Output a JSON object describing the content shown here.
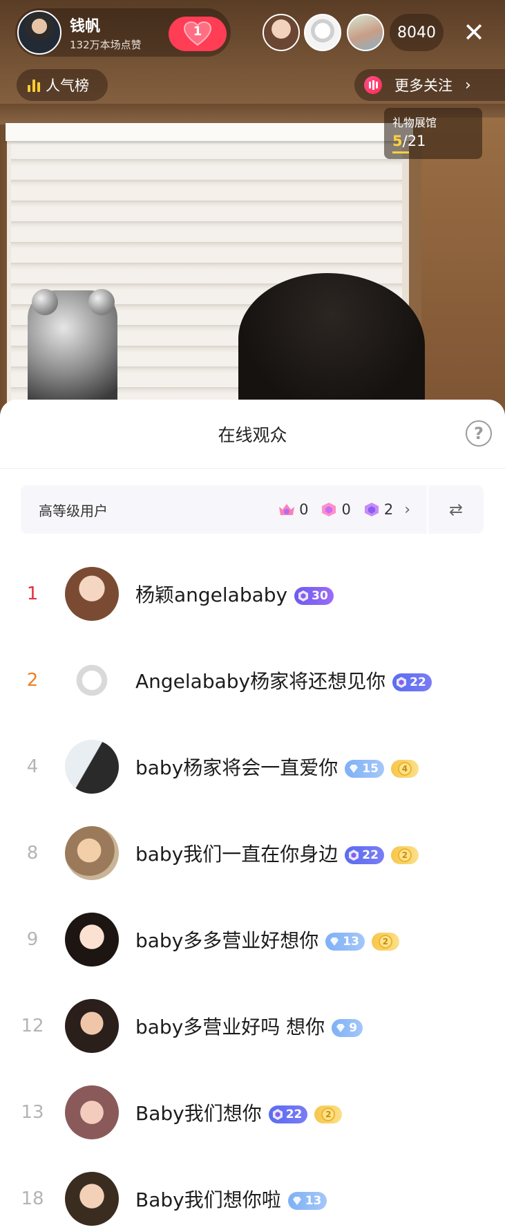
{
  "stream": {
    "host_name": "钱帆",
    "host_likes": "132万本场点赞",
    "like_count": "1",
    "viewer_count": "8040",
    "close_glyph": "✕",
    "popularity_label": "人气榜",
    "more_follow_label": "更多关注",
    "gift_hall": {
      "title": "礼物展馆",
      "current": "5",
      "total": "/21"
    }
  },
  "sheet": {
    "title": "在线观众",
    "help_glyph": "?",
    "level_bar": {
      "label": "高等级用户",
      "stats": [
        {
          "icon": "crown-gem-icon",
          "value": "0"
        },
        {
          "icon": "pink-gem-icon",
          "value": "0"
        },
        {
          "icon": "purple-gem-icon",
          "value": "2"
        }
      ],
      "chevron": "›",
      "swap_glyph": "⇄"
    },
    "viewers": [
      {
        "rank": "1",
        "name": "杨颖angelababy",
        "badges": [
          {
            "type": "purple",
            "value": "30"
          }
        ]
      },
      {
        "rank": "2",
        "name": "Angelababy杨家将还想见你",
        "badges": [
          {
            "type": "indigo",
            "value": "22"
          }
        ]
      },
      {
        "rank": "4",
        "name": "baby杨家将会一直爱你",
        "badges": [
          {
            "type": "blue",
            "value": "15"
          },
          {
            "type": "gold",
            "value": "4"
          }
        ]
      },
      {
        "rank": "8",
        "name": "baby我们一直在你身边",
        "badges": [
          {
            "type": "indigo",
            "value": "22"
          },
          {
            "type": "gold",
            "value": "2"
          }
        ]
      },
      {
        "rank": "9",
        "name": "baby多多营业好想你",
        "badges": [
          {
            "type": "blue",
            "value": "13"
          },
          {
            "type": "gold",
            "value": "2"
          }
        ]
      },
      {
        "rank": "12",
        "name": "baby多营业好吗 想你",
        "badges": [
          {
            "type": "blue",
            "value": "9"
          }
        ]
      },
      {
        "rank": "13",
        "name": "Baby我们想你",
        "badges": [
          {
            "type": "indigo",
            "value": "22"
          },
          {
            "type": "gold",
            "value": "2"
          }
        ]
      },
      {
        "rank": "18",
        "name": "Baby我们想你啦",
        "badges": [
          {
            "type": "blue",
            "value": "13"
          }
        ]
      }
    ]
  },
  "colors": {
    "like_red": "#ff3d55",
    "rank1": "#e03040",
    "rank2": "#ef7f22",
    "gift_yellow": "#ffd23c"
  }
}
